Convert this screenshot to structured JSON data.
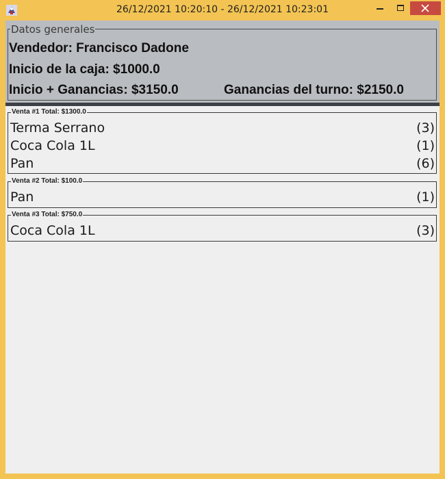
{
  "window": {
    "title": "26/12/2021 10:20:10 - 26/12/2021 10:23:01",
    "icon": "java-app-icon"
  },
  "general": {
    "legend": "Datos generales",
    "seller": "Vendedor: Francisco Dadone",
    "cash_start": "Inicio de la caja: $1000.0",
    "start_plus_earnings": "Inicio + Ganancias: $3150.0",
    "shift_earnings": "Ganancias del turno: $2150.0"
  },
  "sales": [
    {
      "legend": "Venta #1 Total: $1300.0",
      "items": [
        {
          "name": "Terma Serrano",
          "qty": "(3)"
        },
        {
          "name": "Coca Cola 1L",
          "qty": "(1)"
        },
        {
          "name": "Pan",
          "qty": "(6)"
        }
      ]
    },
    {
      "legend": "Venta #2 Total: $100.0",
      "items": [
        {
          "name": "Pan",
          "qty": "(1)"
        }
      ]
    },
    {
      "legend": "Venta #3 Total: $750.0",
      "items": [
        {
          "name": "Coca Cola 1L",
          "qty": "(3)"
        }
      ]
    }
  ]
}
